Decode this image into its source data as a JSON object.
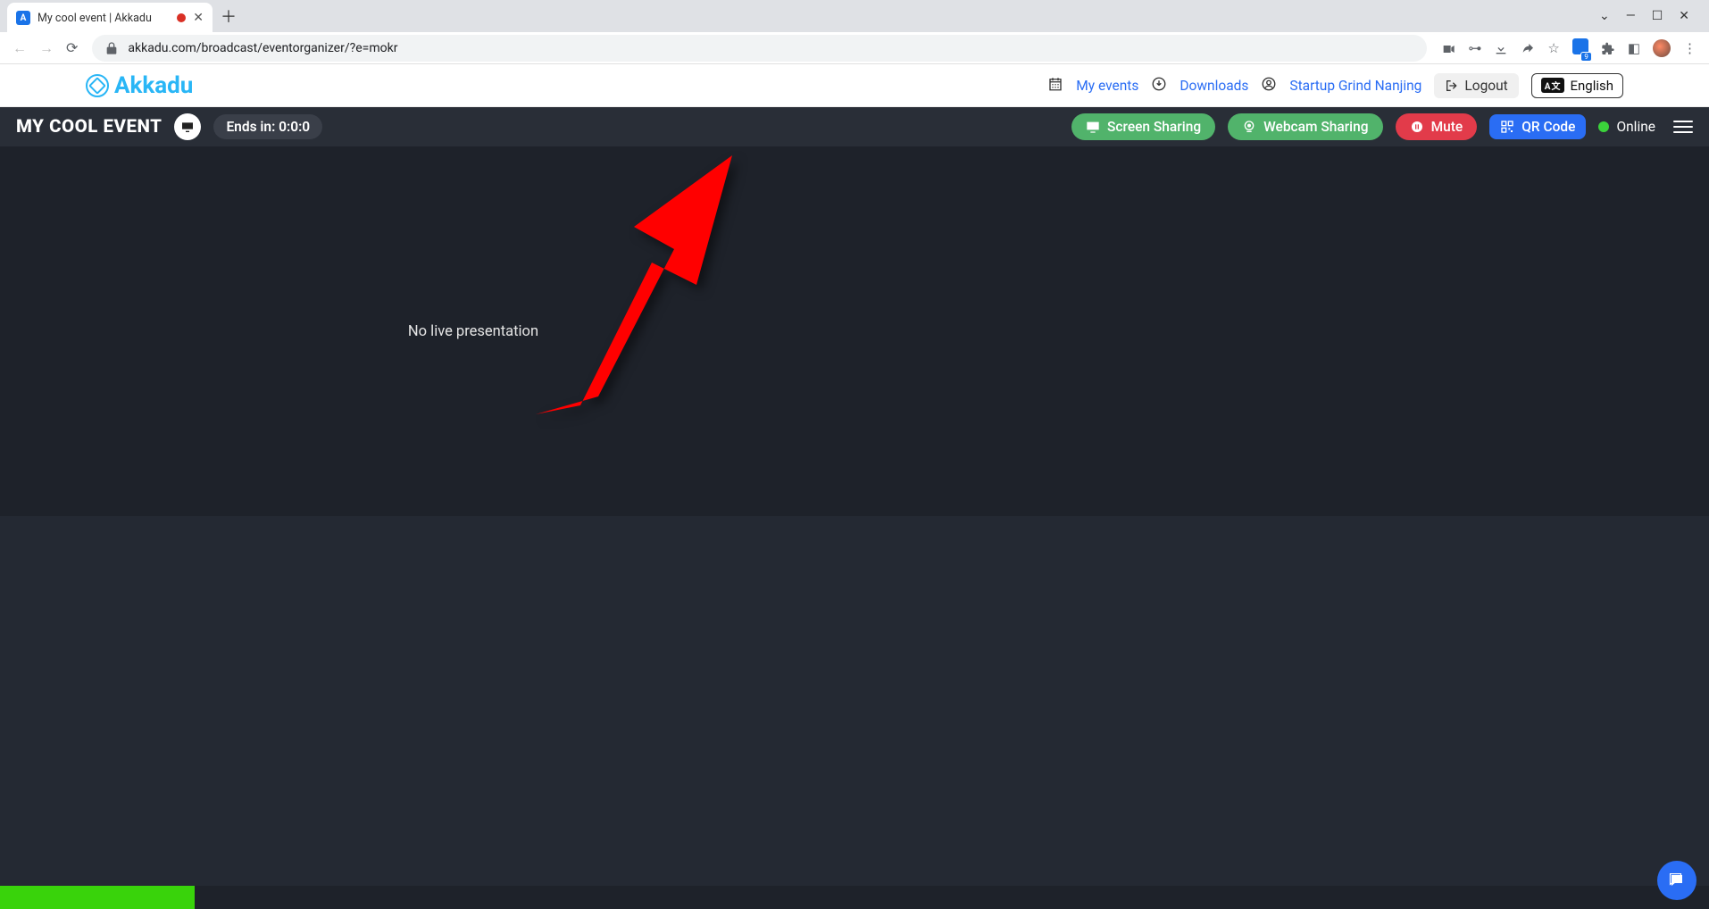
{
  "browser": {
    "tab_title": "My cool event | Akkadu",
    "url": "akkadu.com/broadcast/eventorganizer/?e=mokr",
    "ext_badge_count": "9"
  },
  "header": {
    "logo_text": "Akkadu",
    "my_events": "My events",
    "downloads": "Downloads",
    "startup": "Startup Grind Nanjing",
    "logout": "Logout",
    "language": "English"
  },
  "toolbar": {
    "event_title": "MY COOL EVENT",
    "ends_label": "Ends in: 0:0:0",
    "screen_btn": "Screen Sharing",
    "webcam_btn": "Webcam Sharing",
    "mute_btn": "Mute",
    "qr_btn": "QR Code",
    "online_label": "Online"
  },
  "content": {
    "no_presentation": "No live presentation"
  }
}
